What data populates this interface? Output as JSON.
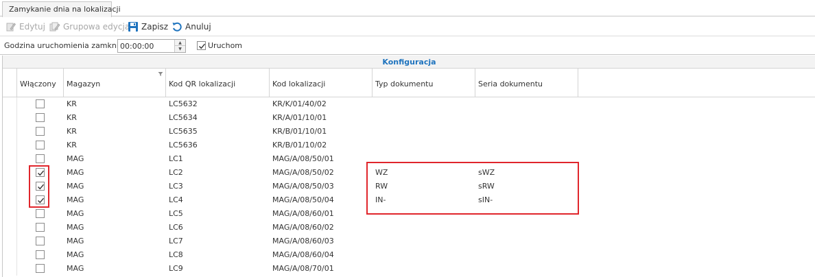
{
  "tab": {
    "label": "Zamykanie dnia na lokalizacji"
  },
  "toolbar": {
    "edit_label": "Edytuj",
    "group_edit_label": "Grupowa edycja",
    "save_label": "Zapisz",
    "cancel_label": "Anuluj"
  },
  "params": {
    "time_label": "Godzina uruchomienia zamknięcia",
    "time_value": "00:00:00",
    "run_label": "Uruchom",
    "run_checked": true
  },
  "grid": {
    "band_title": "Konfiguracja",
    "columns": [
      "Włączony",
      "Magazyn",
      "Kod QR lokalizacji",
      "Kod lokalizacji",
      "Typ dokumentu",
      "Seria dokumentu"
    ],
    "rows": [
      {
        "enabled": false,
        "magazyn": "KR",
        "qr": "LC5632",
        "kod": "KR/K/01/40/02",
        "typ": "",
        "seria": ""
      },
      {
        "enabled": false,
        "magazyn": "KR",
        "qr": "LC5634",
        "kod": "KR/A/01/10/01",
        "typ": "",
        "seria": ""
      },
      {
        "enabled": false,
        "magazyn": "KR",
        "qr": "LC5635",
        "kod": "KR/B/01/10/01",
        "typ": "",
        "seria": ""
      },
      {
        "enabled": false,
        "magazyn": "KR",
        "qr": "LC5636",
        "kod": "KR/B/01/10/02",
        "typ": "",
        "seria": ""
      },
      {
        "enabled": false,
        "magazyn": "MAG",
        "qr": "LC1",
        "kod": "MAG/A/08/50/01",
        "typ": "",
        "seria": ""
      },
      {
        "enabled": true,
        "magazyn": "MAG",
        "qr": "LC2",
        "kod": "MAG/A/08/50/02",
        "typ": "WZ",
        "seria": "sWZ"
      },
      {
        "enabled": true,
        "magazyn": "MAG",
        "qr": "LC3",
        "kod": "MAG/A/08/50/03",
        "typ": "RW",
        "seria": "sRW"
      },
      {
        "enabled": true,
        "magazyn": "MAG",
        "qr": "LC4",
        "kod": "MAG/A/08/50/04",
        "typ": "IN-",
        "seria": "sIN-"
      },
      {
        "enabled": false,
        "magazyn": "MAG",
        "qr": "LC5",
        "kod": "MAG/A/08/60/01",
        "typ": "",
        "seria": ""
      },
      {
        "enabled": false,
        "magazyn": "MAG",
        "qr": "LC6",
        "kod": "MAG/A/08/60/02",
        "typ": "",
        "seria": ""
      },
      {
        "enabled": false,
        "magazyn": "MAG",
        "qr": "LC7",
        "kod": "MAG/A/08/60/03",
        "typ": "",
        "seria": ""
      },
      {
        "enabled": false,
        "magazyn": "MAG",
        "qr": "LC8",
        "kod": "MAG/A/08/60/04",
        "typ": "",
        "seria": ""
      },
      {
        "enabled": false,
        "magazyn": "MAG",
        "qr": "LC9",
        "kod": "MAG/A/08/70/01",
        "typ": "",
        "seria": ""
      }
    ]
  },
  "colors": {
    "band_title": "#1e73be",
    "highlight": "#e0252b",
    "save_icon": "#1e73be"
  },
  "icons": {
    "edit": "edit-icon",
    "group_edit": "group-edit-icon",
    "save": "save-icon",
    "cancel": "undo-icon",
    "filter": "filter-icon",
    "check": "checkmark-icon"
  }
}
